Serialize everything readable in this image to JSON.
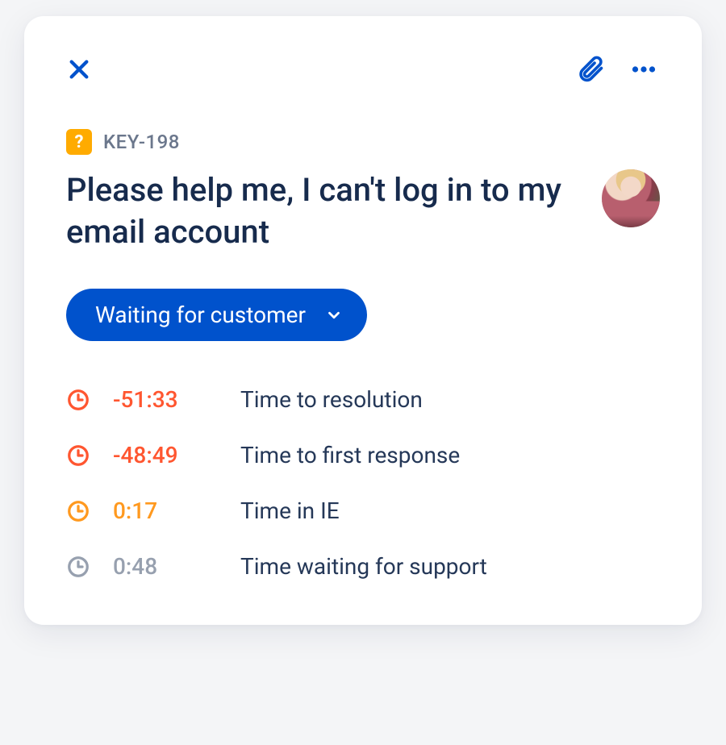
{
  "issue": {
    "key": "KEY-198",
    "type_badge": "?",
    "title": "Please help me, I can't log in to my email account"
  },
  "status": {
    "label": "Waiting for customer"
  },
  "sla": [
    {
      "value": "-51:33",
      "label": "Time to resolution",
      "state": "breached"
    },
    {
      "value": "-48:49",
      "label": "Time to first response",
      "state": "breached"
    },
    {
      "value": "0:17",
      "label": "Time in IE",
      "state": "warning"
    },
    {
      "value": "0:48",
      "label": "Time waiting for support",
      "state": "paused"
    }
  ],
  "colors": {
    "breached": "#FF5630",
    "warning": "#FF991F",
    "paused": "#97A0AF",
    "primary": "#0052CC"
  }
}
